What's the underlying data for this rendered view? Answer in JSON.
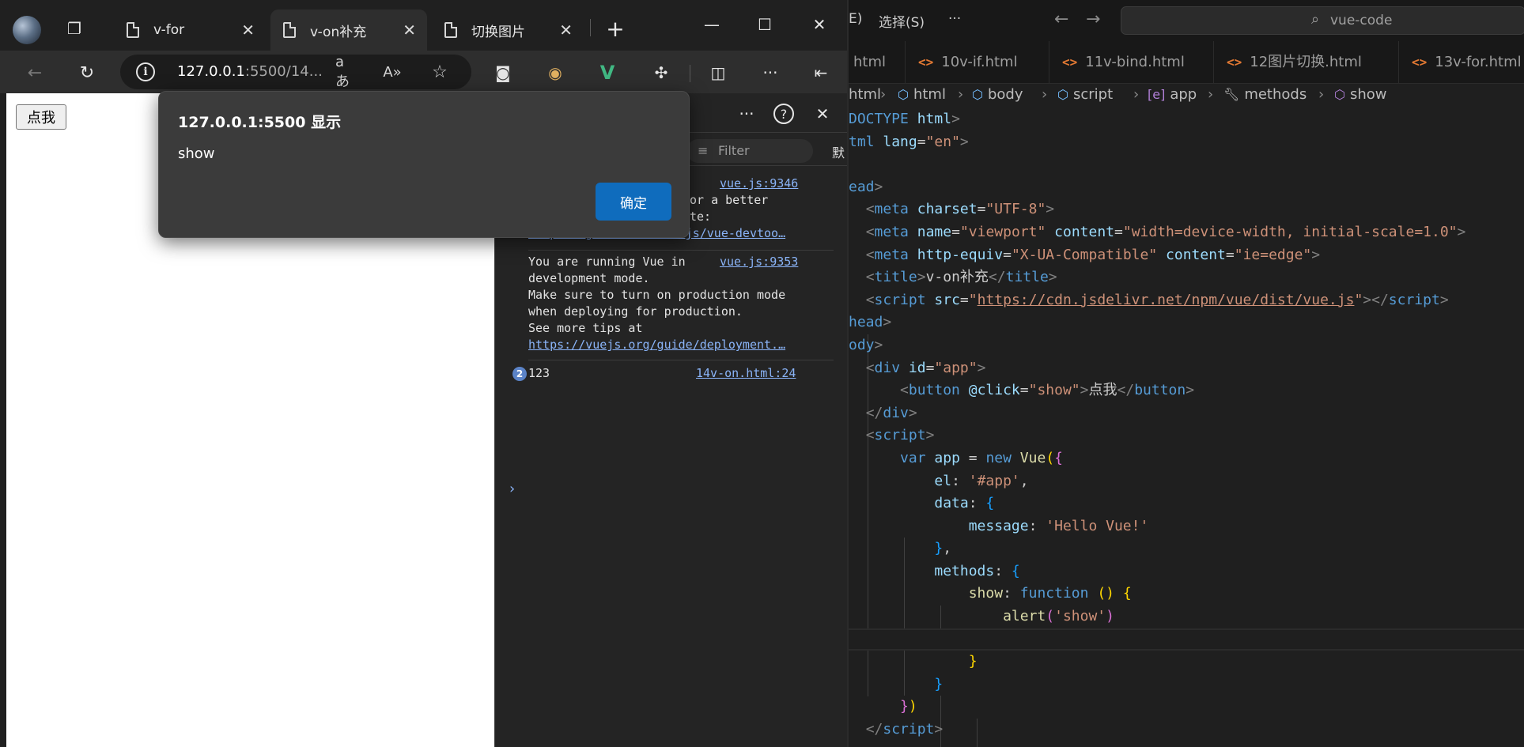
{
  "browser": {
    "tabs": [
      {
        "label": "v-for"
      },
      {
        "label": "v-on补充"
      },
      {
        "label": "切换图片"
      }
    ],
    "new_tab_label": "+",
    "address": {
      "host": "127.0.0.1",
      "rest": ":5500/14..."
    },
    "page_button_label": "点我"
  },
  "devtools": {
    "filter_placeholder": "Filter",
    "default_levels_partial": "默",
    "messages": [
      {
        "text_lines": [
          "or a better",
          "te:"
        ],
        "link": "https://github.com/vuejs/vue-devtoo…",
        "source": "vue.js:9346"
      },
      {
        "text_lines": [
          "You are running Vue in",
          "development mode.",
          "Make sure to turn on production mode",
          "when deploying for production.",
          "See more tips at"
        ],
        "link": "https://vuejs.org/guide/deployment.…",
        "source": "vue.js:9353"
      },
      {
        "text_lines": [
          "123"
        ],
        "count": "2",
        "source": "14v-on.html:24"
      }
    ]
  },
  "alert": {
    "title": "127.0.0.1:5500 显示",
    "message": "show",
    "ok_label": "确定"
  },
  "vscode": {
    "menu_partial": "E)",
    "menu_select": "选择(S)",
    "menu_more": "···",
    "search_text": "vue-code",
    "tabs": [
      {
        "label": "html"
      },
      {
        "label": "10v-if.html"
      },
      {
        "label": "11v-bind.html"
      },
      {
        "label": "12图片切换.html"
      },
      {
        "label": "13v-for.html"
      }
    ],
    "breadcrumbs": [
      "html",
      "html",
      "body",
      "script",
      "app",
      "methods",
      "show"
    ],
    "colors": {
      "accent_tag": "#e37933",
      "string": "#ce9178",
      "keyword": "#569cd6"
    }
  }
}
